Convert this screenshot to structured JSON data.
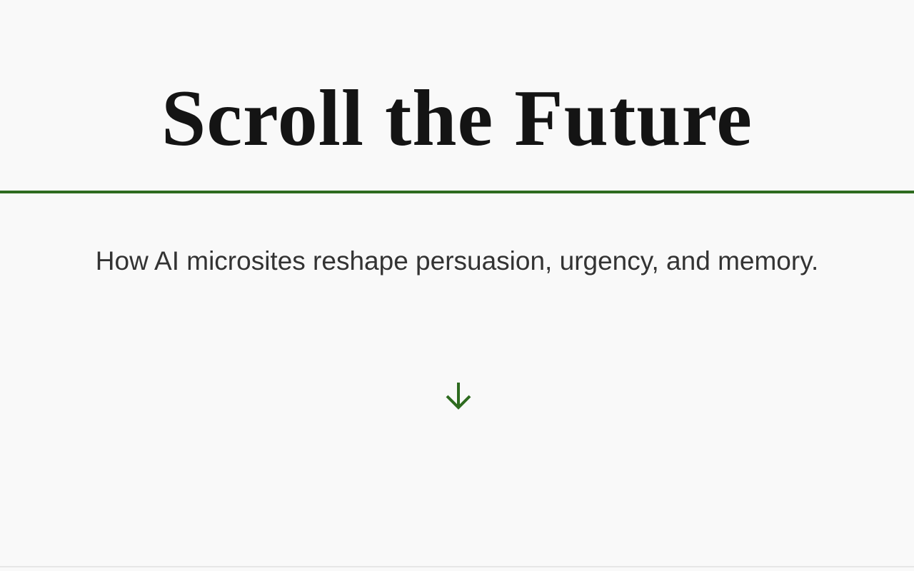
{
  "hero": {
    "title": "Scroll the Future",
    "subtitle": "How AI microsites reshape persuasion, urgency, and memory."
  },
  "scroll_cue": {
    "icon": "arrow-down-icon"
  },
  "colors": {
    "background": "#f9f9f9",
    "title_text": "#141414",
    "subtitle_text": "#333333",
    "accent": "#2e6b1f",
    "bottom_rule": "#e6e6e6"
  }
}
